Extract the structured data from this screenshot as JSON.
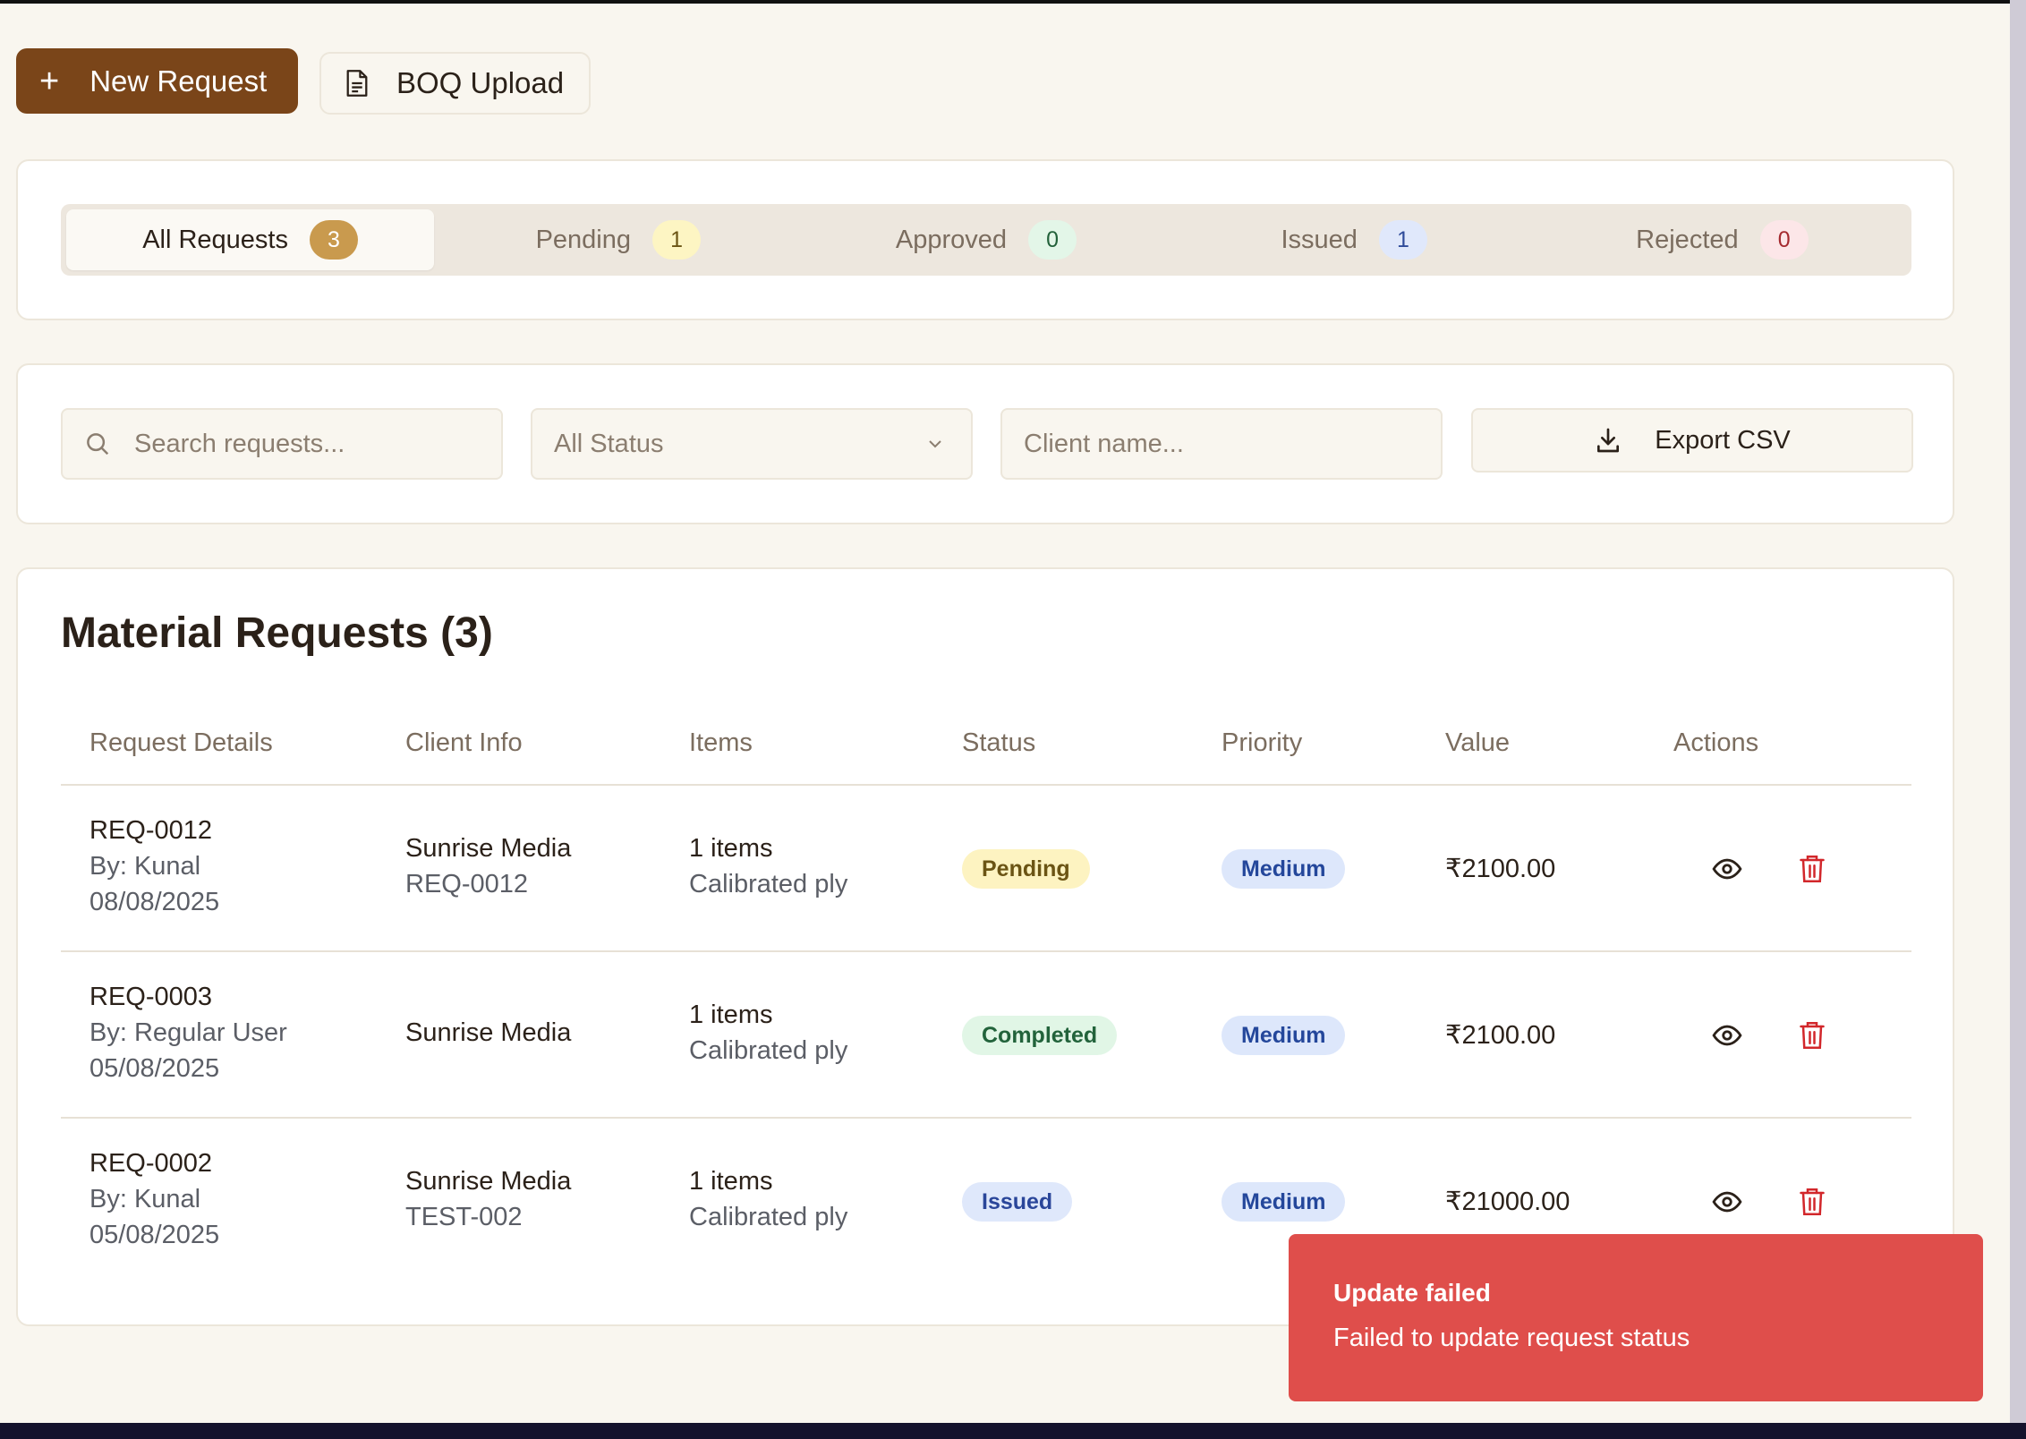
{
  "toolbar": {
    "new_request_label": "New Request",
    "boq_upload_label": "BOQ Upload"
  },
  "tabs": [
    {
      "label": "All Requests",
      "count": "3",
      "badge_bg": "#c99a4e",
      "badge_fg": "#ffffff"
    },
    {
      "label": "Pending",
      "count": "1",
      "badge_bg": "#fdf5c3",
      "badge_fg": "#6b5414"
    },
    {
      "label": "Approved",
      "count": "0",
      "badge_bg": "#e3f6e8",
      "badge_fg": "#23613a"
    },
    {
      "label": "Issued",
      "count": "1",
      "badge_bg": "#e0e8fb",
      "badge_fg": "#2f4b9a"
    },
    {
      "label": "Rejected",
      "count": "0",
      "badge_bg": "#fce6e8",
      "badge_fg": "#a42a2f"
    }
  ],
  "filters": {
    "search_placeholder": "Search requests...",
    "status_value": "All Status",
    "client_placeholder": "Client name...",
    "export_label": "Export CSV"
  },
  "table": {
    "title": "Material Requests (3)",
    "headers": [
      "Request Details",
      "Client Info",
      "Items",
      "Status",
      "Priority",
      "Value",
      "Actions"
    ],
    "rows": [
      {
        "id": "REQ-0012",
        "by": "By: Kunal",
        "date": "08/08/2025",
        "client": "Sunrise Media",
        "client_ref": "REQ-0012",
        "items": "1 items",
        "item_name": "Calibrated ply",
        "status": "Pending",
        "priority": "Medium",
        "value": "₹2100.00"
      },
      {
        "id": "REQ-0003",
        "by": "By: Regular User",
        "date": "05/08/2025",
        "client": "Sunrise Media",
        "client_ref": "",
        "items": "1 items",
        "item_name": "Calibrated ply",
        "status": "Completed",
        "priority": "Medium",
        "value": "₹2100.00"
      },
      {
        "id": "REQ-0002",
        "by": "By: Kunal",
        "date": "05/08/2025",
        "client": "Sunrise Media",
        "client_ref": "TEST-002",
        "items": "1 items",
        "item_name": "Calibrated ply",
        "status": "Issued",
        "priority": "Medium",
        "value": "₹21000.00"
      }
    ]
  },
  "status_colors": {
    "Pending": {
      "bg": "#fdf3c1",
      "fg": "#6b5414"
    },
    "Completed": {
      "bg": "#e1f6e6",
      "fg": "#22633b"
    },
    "Issued": {
      "bg": "#dfe8fb",
      "fg": "#2a469a"
    }
  },
  "priority_colors": {
    "Medium": {
      "bg": "#dde7fb",
      "fg": "#24479b"
    }
  },
  "toast": {
    "title": "Update failed",
    "message": "Failed to update request status"
  },
  "icons": [
    "plus-icon",
    "document-icon",
    "search-icon",
    "chevron-down-icon",
    "download-icon",
    "eye-icon",
    "trash-icon"
  ],
  "accent": "#7a4519"
}
